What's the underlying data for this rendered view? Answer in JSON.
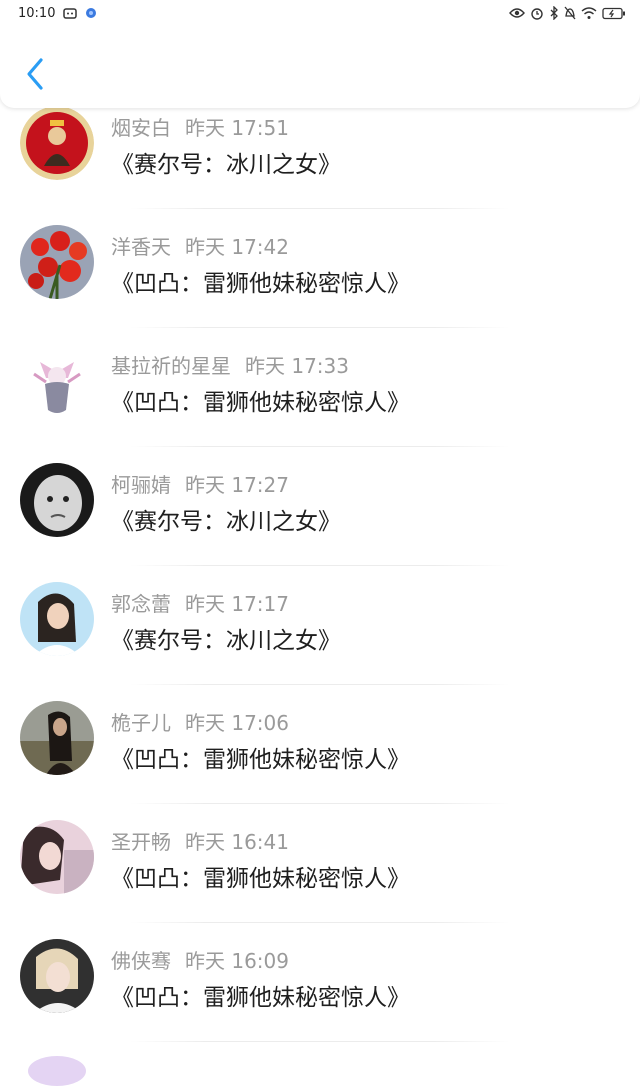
{
  "status": {
    "time": "10:10"
  },
  "colors": {
    "accent": "#2a9df4",
    "name": "#9a9a9a",
    "title": "#1f1f1f"
  },
  "items": [
    {
      "name": "烟安白",
      "time": "昨天 17:51",
      "title": "《赛尔号：冰川之女》",
      "avatar": "avatar-red-figure"
    },
    {
      "name": "洋香天",
      "time": "昨天 17:42",
      "title": "《凹凸：雷狮他妹秘密惊人》",
      "avatar": "avatar-red-flowers"
    },
    {
      "name": "基拉祈的星星",
      "time": "昨天 17:33",
      "title": "《凹凸：雷狮他妹秘密惊人》",
      "avatar": "avatar-anime-doll"
    },
    {
      "name": "柯骊婧",
      "time": "昨天 17:27",
      "title": "《赛尔号：冰川之女》",
      "avatar": "avatar-bw-child"
    },
    {
      "name": "郭念蕾",
      "time": "昨天 17:17",
      "title": "《赛尔号：冰川之女》",
      "avatar": "avatar-girl-sky"
    },
    {
      "name": "桅子儿",
      "time": "昨天 17:06",
      "title": "《凹凸：雷狮他妹秘密惊人》",
      "avatar": "avatar-girl-field"
    },
    {
      "name": "圣开畅",
      "time": "昨天 16:41",
      "title": "《凹凸：雷狮他妹秘密惊人》",
      "avatar": "avatar-girl-pink"
    },
    {
      "name": "佛侠骞",
      "time": "昨天 16:09",
      "title": "《凹凸：雷狮他妹秘密惊人》",
      "avatar": "avatar-girl-blonde"
    }
  ]
}
